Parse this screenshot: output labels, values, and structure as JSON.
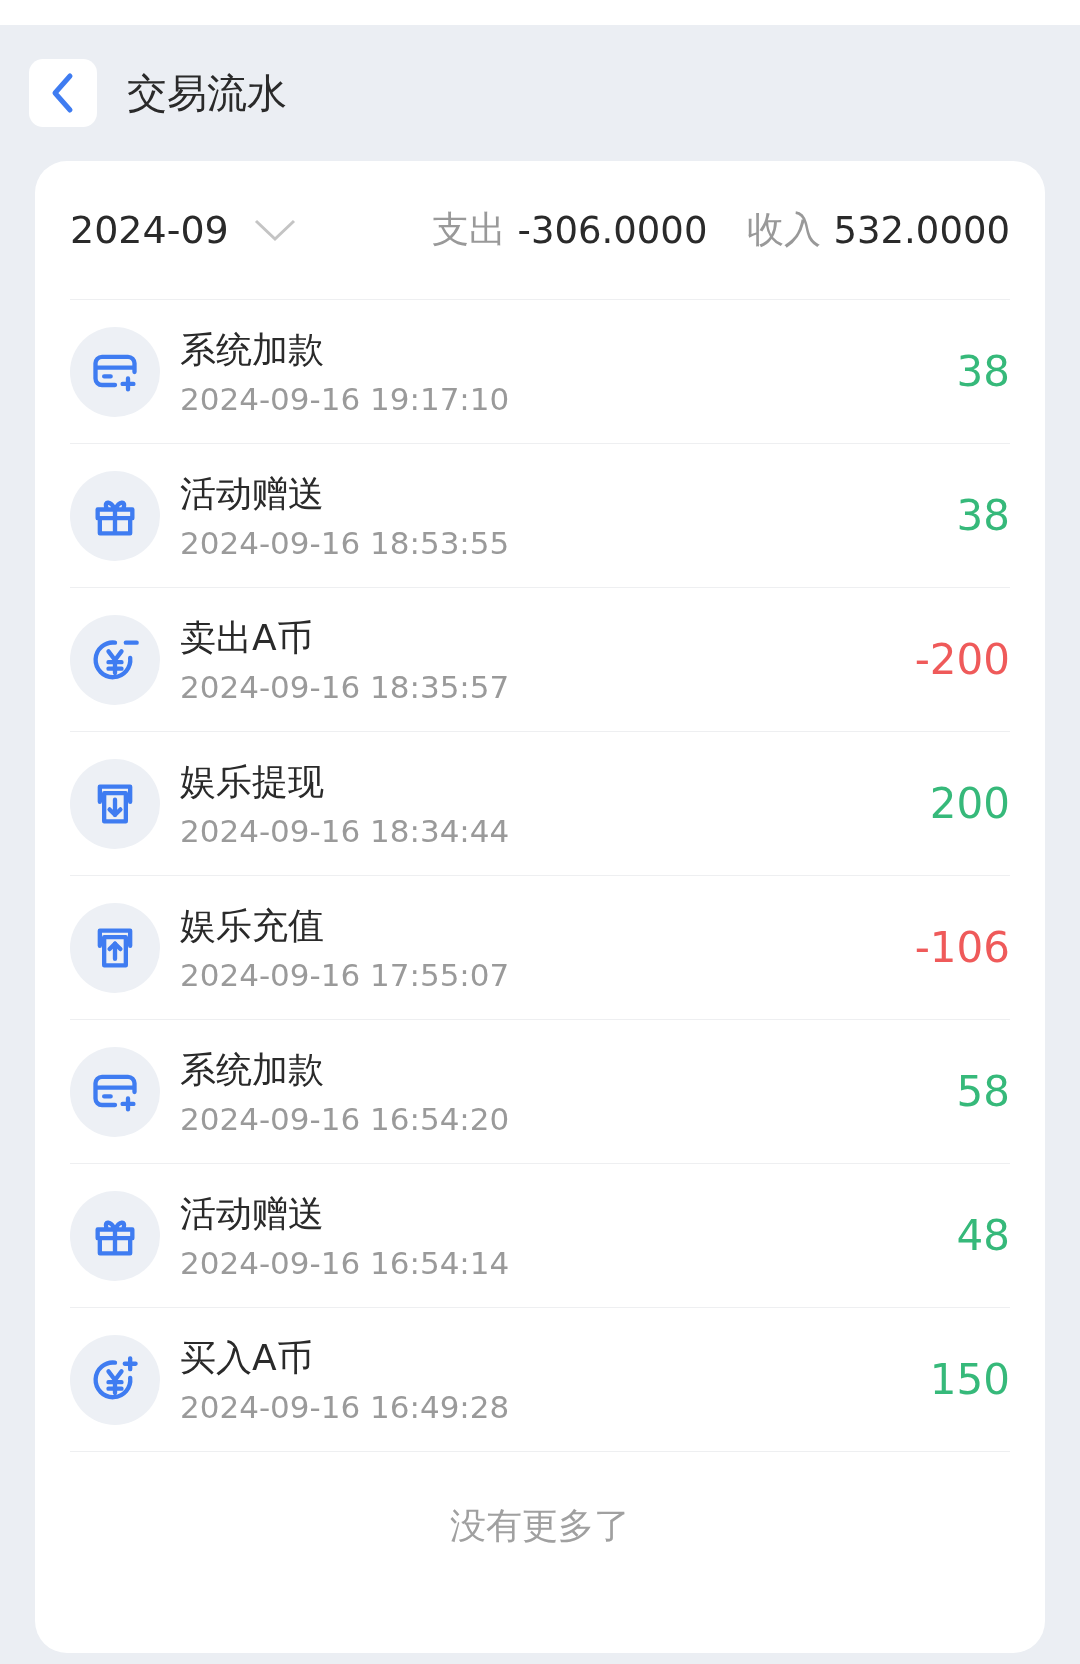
{
  "header": {
    "title": "交易流水"
  },
  "summary": {
    "month": "2024-09",
    "expense_label": "支出",
    "expense": "-306.0000",
    "income_label": "收入",
    "income": "532.0000"
  },
  "transactions": [
    {
      "kind": "card",
      "name": "系统加款",
      "time": "2024-09-16 19:17:10",
      "amount": "38",
      "color": "#36b97a"
    },
    {
      "kind": "gift",
      "name": "活动赠送",
      "time": "2024-09-16 18:53:55",
      "amount": "38",
      "color": "#36b97a"
    },
    {
      "kind": "coin-minus",
      "name": "卖出A币",
      "time": "2024-09-16 18:35:57",
      "amount": "-200",
      "color": "#ef5a5a"
    },
    {
      "kind": "withdraw",
      "name": "娱乐提现",
      "time": "2024-09-16 18:34:44",
      "amount": "200",
      "color": "#36b97a"
    },
    {
      "kind": "deposit",
      "name": "娱乐充值",
      "time": "2024-09-16 17:55:07",
      "amount": "-106",
      "color": "#ef5a5a"
    },
    {
      "kind": "card",
      "name": "系统加款",
      "time": "2024-09-16 16:54:20",
      "amount": "58",
      "color": "#36b97a"
    },
    {
      "kind": "gift",
      "name": "活动赠送",
      "time": "2024-09-16 16:54:14",
      "amount": "48",
      "color": "#36b97a"
    },
    {
      "kind": "coin-plus",
      "name": "买入A币",
      "time": "2024-09-16 16:49:28",
      "amount": "150",
      "color": "#36b97a"
    }
  ],
  "footer": "没有更多了"
}
